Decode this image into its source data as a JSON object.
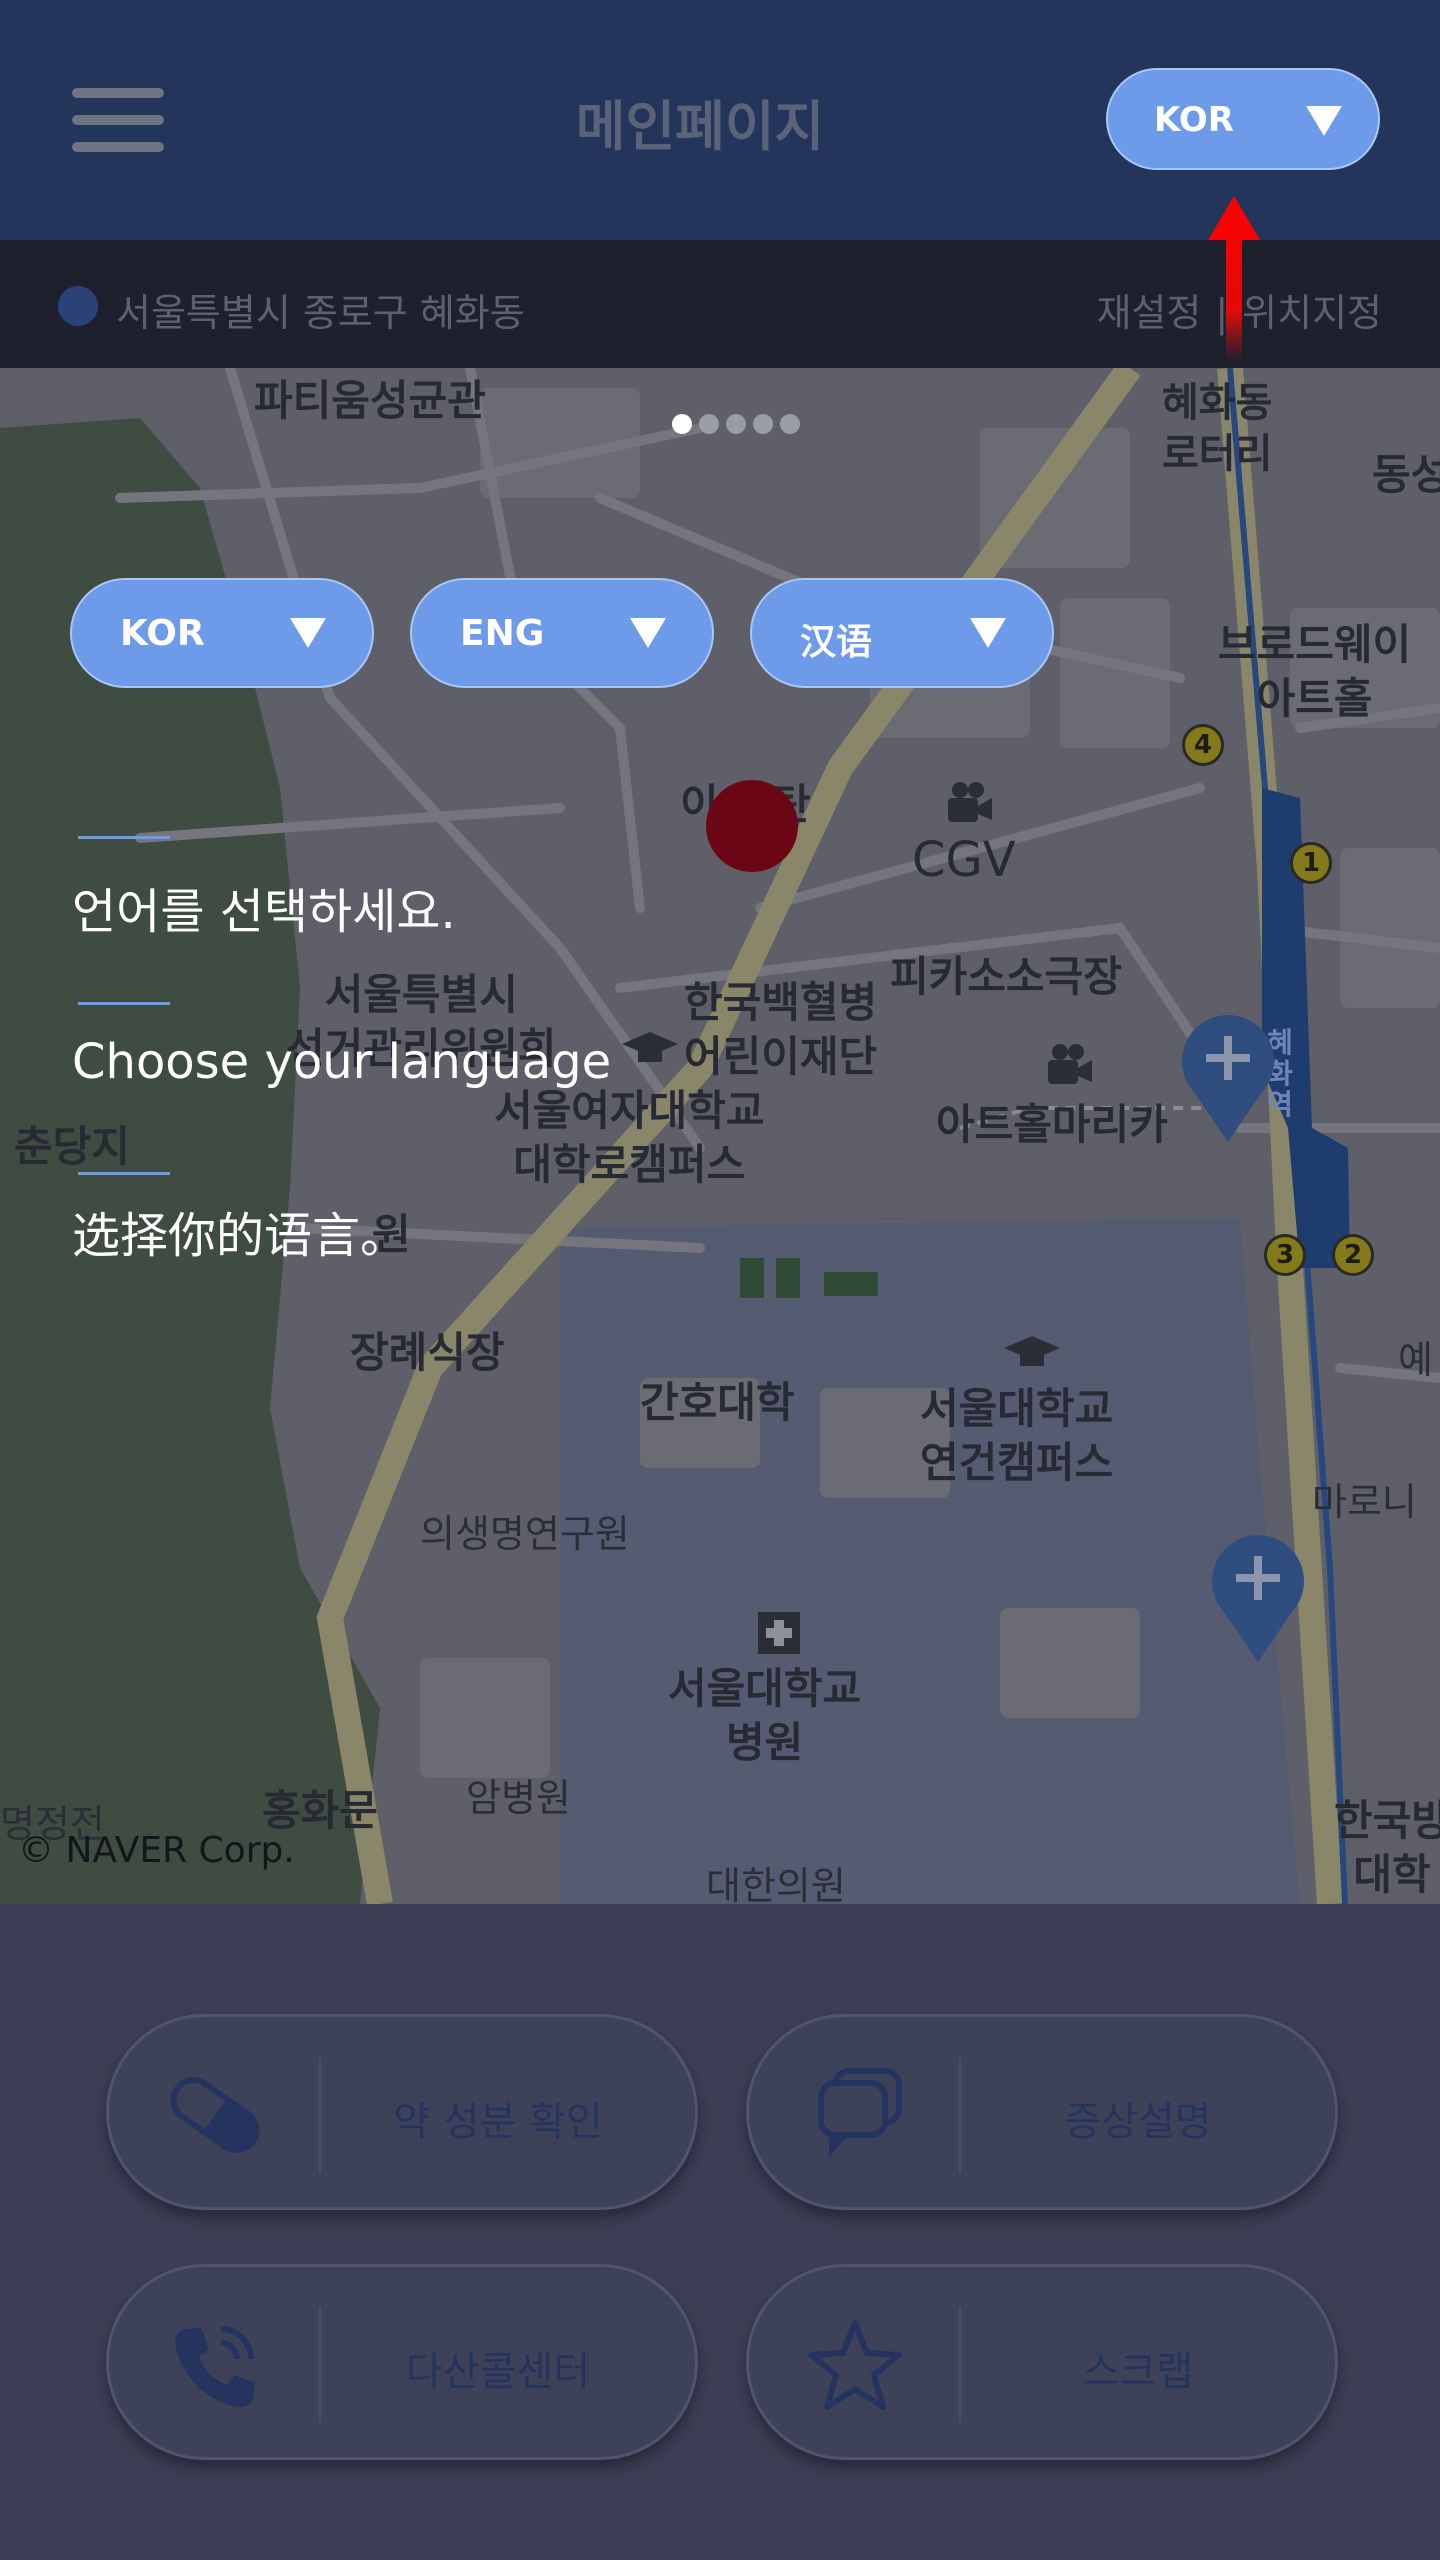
{
  "header": {
    "title": "메인페이지",
    "language_selector": "KOR"
  },
  "location": {
    "address": "서울특별시 종로구 혜화동",
    "reset_label": "재설정",
    "separator": "|",
    "set_location_label": "위치지정"
  },
  "map": {
    "labels": [
      "파티움성균관",
      "혜화동\n로터리",
      "동성",
      "브로드웨이\n아트홀",
      "이 스탄",
      "CGV",
      "피카소소극장",
      "서울특별시\n선거관리위원회",
      "한국백혈병\n어린이재단",
      "서울여자대학교\n대학로캠퍼스",
      "아트홀마리카",
      "춘당지",
      "원",
      "장례식장",
      "간호대학",
      "서울대학교\n연건캠퍼스",
      "의생명연구원",
      "마로니",
      "예",
      "서울대학교\n병원",
      "홍화문",
      "암병원",
      "명정전",
      "대한의원",
      "한국방\n대학"
    ],
    "metro_lines": [
      "4",
      "1",
      "3",
      "2"
    ],
    "station_name": "혜화역",
    "copyright": "© NAVER Corp."
  },
  "carousel": {
    "count": 5,
    "active": 1
  },
  "language_options": [
    {
      "label": "KOR"
    },
    {
      "label": "ENG"
    },
    {
      "label": "汉语"
    }
  ],
  "prompts": {
    "korean": "언어를 선택하세요.",
    "english": "Choose your language",
    "chinese": "选择你的语言。"
  },
  "actions": [
    {
      "label": "약 성분 확인",
      "icon": "pill-icon"
    },
    {
      "label": "증상설명",
      "icon": "chat-bubbles-icon"
    },
    {
      "label": "다산콜센터",
      "icon": "phone-icon"
    },
    {
      "label": "스크랩",
      "icon": "star-icon"
    }
  ],
  "colors": {
    "header_bg": "#24355c",
    "accent": "#6d9be9",
    "overlay": "#3c3f55",
    "marker_red": "#6b0714",
    "annotation_arrow": "#ff0000"
  }
}
